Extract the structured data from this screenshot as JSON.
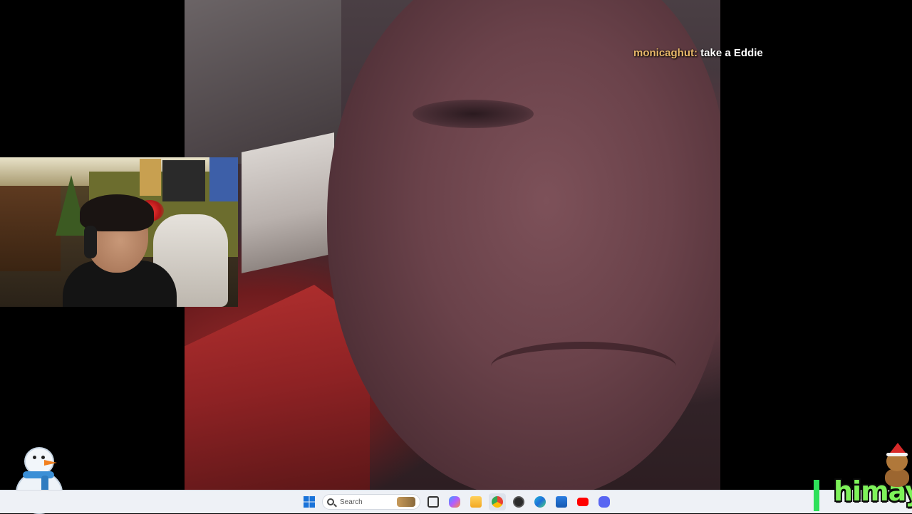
{
  "chat": {
    "username": "monicaghut:",
    "message": "take a Eddie",
    "username_color": "#e8b86a"
  },
  "taskbar": {
    "search": {
      "placeholder": "Search"
    },
    "icons": [
      "windows-start-icon",
      "search-icon",
      "task-view-icon",
      "copilot-icon",
      "file-explorer-icon",
      "chrome-icon",
      "obs-icon",
      "edge-icon",
      "microsoft-store-icon",
      "youtube-icon",
      "discord-icon"
    ]
  },
  "branding": {
    "logo_text": "himay",
    "logo_color": "#7ef25a"
  }
}
